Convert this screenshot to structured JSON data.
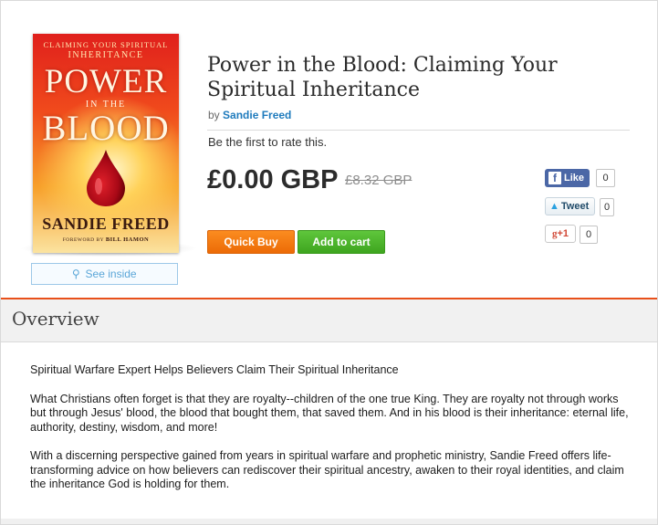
{
  "book": {
    "title": "Power in the Blood: Claiming Your Spiritual Inheritance",
    "by_label": "by",
    "author": "Sandie Freed",
    "rating_prompt": "Be the first to rate this.",
    "price": "£0.00 GBP",
    "original_price": "£8.32 GBP"
  },
  "cover": {
    "subtitle_line1": "CLAIMING YOUR SPIRITUAL",
    "subtitle_line2": "INHERITANCE",
    "title_line1": "POWER",
    "title_line2": "IN THE",
    "title_line3": "BLOOD",
    "author": "SANDIE FREED",
    "foreword_label": "FOREWORD BY",
    "foreword_name": "BILL HAMON"
  },
  "actions": {
    "see_inside": "See inside",
    "quick_buy": "Quick Buy",
    "add_to_cart": "Add to cart"
  },
  "social": {
    "facebook_label": "Like",
    "facebook_count": "0",
    "twitter_label": "Tweet",
    "twitter_count": "0",
    "gplus_label": "+1",
    "gplus_count": "0"
  },
  "overview": {
    "heading": "Overview",
    "paragraphs": [
      "Spiritual Warfare Expert Helps Believers Claim Their Spiritual Inheritance",
      "What Christians often forget is that they are royalty--children of the one true King. They are royalty not through works but through Jesus' blood, the blood that bought them, that saved them. And in his blood is their inheritance: eternal life, authority, destiny, wisdom, and more!",
      "With a discerning perspective gained from years in spiritual warfare and prophetic ministry, Sandie Freed offers life-transforming advice on how believers can rediscover their spiritual ancestry, awaken to their royal identities, and claim the inheritance God is holding for them."
    ]
  },
  "colors": {
    "accent_orange": "#e8501a",
    "quick_buy": "#f47b10",
    "add_to_cart": "#4cb52b",
    "author_link": "#1f7bbd",
    "facebook": "#4b67a6"
  },
  "icons": {
    "see_inside": "magnifier-icon",
    "facebook": "facebook-f-icon",
    "twitter": "twitter-bird-icon",
    "gplus": "google-plus-icon"
  }
}
